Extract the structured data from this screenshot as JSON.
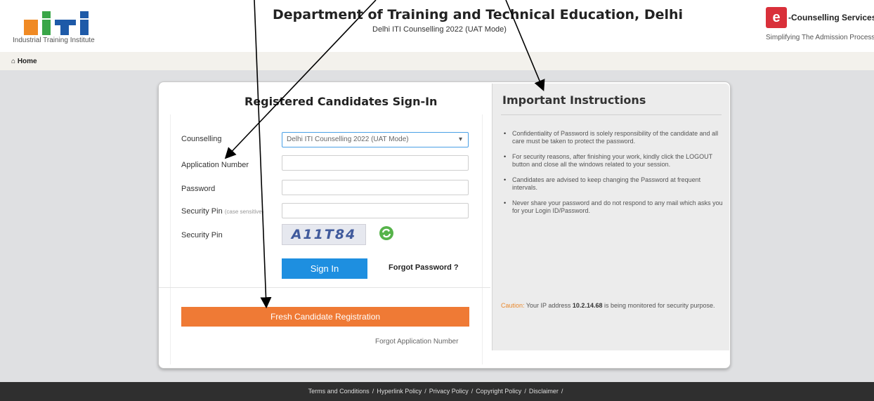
{
  "header": {
    "iti_caption": "Industrial Training Institute",
    "title": "Department of Training and Technical Education, Delhi",
    "subtitle": "Delhi ITI Counselling 2022 (UAT Mode)",
    "ec_badge": "e",
    "ec_name": "-Counselling Services",
    "ec_tagline": "Simplifying The Admission Process"
  },
  "nav": {
    "home": "Home"
  },
  "signin": {
    "title": "Registered Candidates Sign-In",
    "counselling_label": "Counselling",
    "counselling_value": "Delhi ITI Counselling 2022 (UAT Mode)",
    "application_label": "Application Number",
    "password_label": "Password",
    "security_pin_label": "Security Pin",
    "security_pin_hint": "(case sensitive)",
    "security_pin_label2": "Security Pin",
    "captcha_text": "A11T84",
    "signin_button": "Sign In",
    "forgot_password": "Forgot Password ?",
    "fresh_registration": "Fresh Candidate Registration",
    "forgot_application": "Forgot Application Number"
  },
  "instructions": {
    "title": "Important Instructions",
    "items": [
      "Confidentiality of Password is solely responsibility of the candidate and all care must be taken to protect the password.",
      "For security reasons, after finishing your work, kindly click the LOGOUT button and close all the windows related to your session.",
      "Candidates are advised to keep changing the Password at frequent intervals.",
      "Never share your password and do not respond to any mail which asks you for your Login ID/Password."
    ],
    "caution_label": "Caution:",
    "caution_pre": " Your IP address ",
    "caution_ip": "10.2.14.68",
    "caution_post": " is being monitored for security purpose."
  },
  "footer": {
    "links": [
      "Terms and Conditions",
      "Hyperlink Policy",
      "Privacy Policy",
      "Copyright Policy",
      "Disclaimer"
    ],
    "separator": "/"
  },
  "colors": {
    "signin_blue": "#1e8fe0",
    "registration_orange": "#ef7a35",
    "caution_orange": "#e9892e",
    "footer_dark": "#2f2f2f"
  },
  "icons": {
    "home": "home-icon",
    "refresh": "refresh-captcha-icon",
    "dropdown": "chevron-down-icon"
  }
}
